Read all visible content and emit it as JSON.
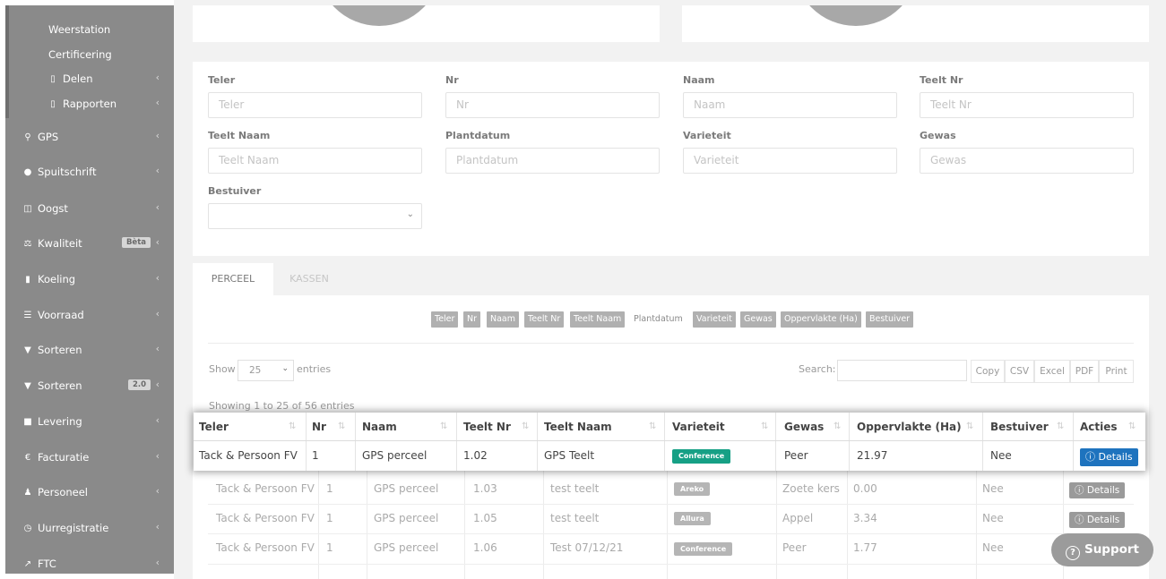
{
  "sidebar": {
    "items": [
      {
        "label": "Weerstation",
        "icon": "",
        "chev": false
      },
      {
        "label": "Certificering",
        "icon": "",
        "chev": false
      },
      {
        "label": "Delen",
        "icon": "folder-icon",
        "chev": true
      },
      {
        "label": "Rapporten",
        "icon": "folder-icon",
        "chev": true
      },
      {
        "label": "GPS",
        "icon": "map-marker-icon",
        "chev": true
      },
      {
        "label": "Spuitschrift",
        "icon": "drop-icon",
        "chev": true
      },
      {
        "label": "Oogst",
        "icon": "basket-icon",
        "chev": true
      },
      {
        "label": "Kwaliteit",
        "icon": "balance-scale-icon",
        "chev": true,
        "badge": "Bèta"
      },
      {
        "label": "Koeling",
        "icon": "thermometer-icon",
        "chev": true
      },
      {
        "label": "Voorraad",
        "icon": "list-icon",
        "chev": true
      },
      {
        "label": "Sorteren",
        "icon": "filter-icon",
        "chev": true
      },
      {
        "label": "Sorteren",
        "icon": "filter-icon",
        "chev": true,
        "badge": "2.0"
      },
      {
        "label": "Levering",
        "icon": "truck-icon",
        "chev": true
      },
      {
        "label": "Facturatie",
        "icon": "euro-icon",
        "chev": true
      },
      {
        "label": "Personeel",
        "icon": "user-icon",
        "chev": true
      },
      {
        "label": "Uurregistratie",
        "icon": "clock-icon",
        "chev": true
      },
      {
        "label": "FTC",
        "icon": "line-chart-icon",
        "chev": true
      }
    ]
  },
  "filters": {
    "teler": {
      "label": "Teler",
      "placeholder": "Teler"
    },
    "nr": {
      "label": "Nr",
      "placeholder": "Nr"
    },
    "naam": {
      "label": "Naam",
      "placeholder": "Naam"
    },
    "teelt_nr": {
      "label": "Teelt Nr",
      "placeholder": "Teelt Nr"
    },
    "teelt_naam": {
      "label": "Teelt Naam",
      "placeholder": "Teelt Naam"
    },
    "plantdatum": {
      "label": "Plantdatum",
      "placeholder": "Plantdatum"
    },
    "varieteit": {
      "label": "Varieteit",
      "placeholder": "Varieteit"
    },
    "gewas": {
      "label": "Gewas",
      "placeholder": "Gewas"
    },
    "bestuiver": {
      "label": "Bestuiver",
      "value": ""
    }
  },
  "tabs": {
    "perceel": "PERCEEL",
    "kassen": "KASSEN"
  },
  "column_toggles": [
    "Teler",
    "Nr",
    "Naam",
    "Teelt Nr",
    "Teelt Naam",
    "Plantdatum",
    "Varieteit",
    "Gewas",
    "Oppervlakte (Ha)",
    "Bestuiver"
  ],
  "controls": {
    "show_label": "Show",
    "show_value": "25",
    "entries_label": "entries",
    "search_label": "Search:",
    "export_buttons": [
      "Copy",
      "CSV",
      "Excel",
      "PDF",
      "Print"
    ],
    "info": "Showing 1 to 25 of 56 entries"
  },
  "table": {
    "headers": [
      "Teler",
      "Nr",
      "Naam",
      "Teelt Nr",
      "Teelt Naam",
      "Varieteit",
      "Gewas",
      "Oppervlakte (Ha)",
      "Bestuiver",
      "Acties"
    ],
    "rows": [
      [
        "Tack & Persoon FV",
        "1",
        "GPS perceel",
        "1.02",
        "GPS Teelt",
        "Conference",
        "Peer",
        "21.97",
        "Nee",
        "Details"
      ],
      [
        "Tack & Persoon FV",
        "1",
        "GPS perceel",
        "1.03",
        "test teelt",
        "Areko",
        "Zoete kers",
        "0.00",
        "Nee",
        "Details"
      ],
      [
        "Tack & Persoon FV",
        "1",
        "GPS perceel",
        "1.05",
        "test teelt",
        "Allura",
        "Appel",
        "3.34",
        "Nee",
        "Details"
      ],
      [
        "Tack & Persoon FV",
        "1",
        "GPS perceel",
        "1.06",
        "Test 07/12/21",
        "Conference",
        "Peer",
        "1.77",
        "Nee",
        "Details"
      ]
    ]
  },
  "support": {
    "label": "Support"
  },
  "colors": {
    "accent_green": "#16a085",
    "accent_blue": "#1e73be",
    "sidebar": "#8a8a8a"
  }
}
